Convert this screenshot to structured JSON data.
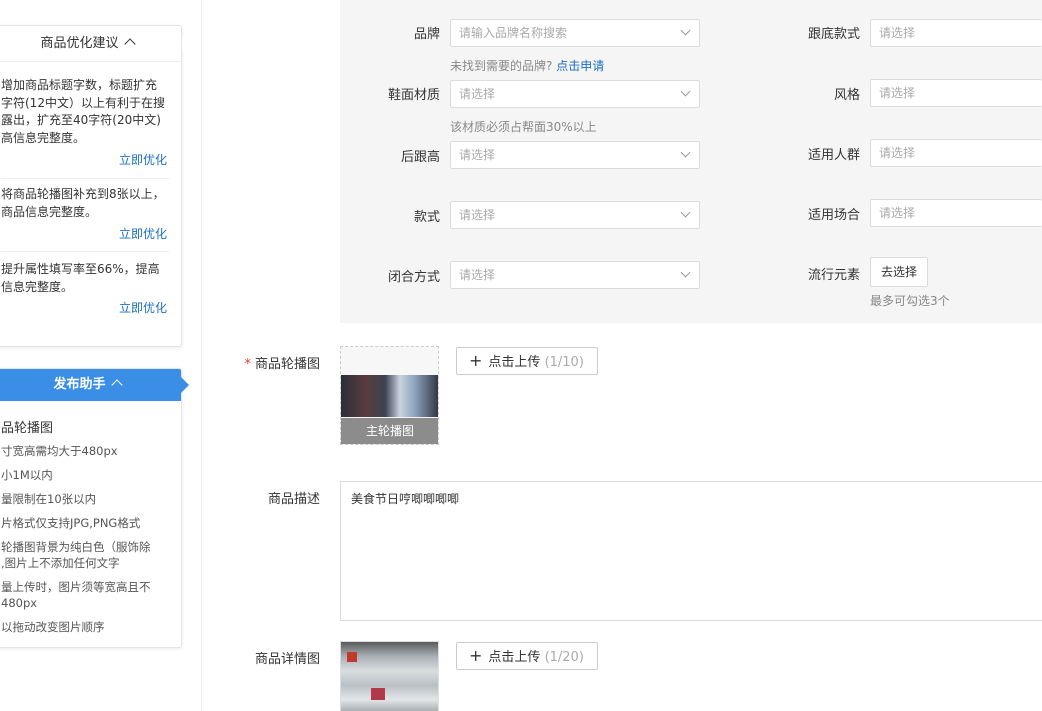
{
  "sidebar": {
    "optimize": {
      "title": "商品优化建议",
      "items": [
        {
          "lines": [
            "增加商品标题字数，标题扩充",
            "字符(12中文）以上有利于在搜",
            "露出，扩充至40字符(20中文)",
            "高信息完整度。"
          ],
          "link": "立即优化"
        },
        {
          "lines": [
            "将商品轮播图补充到8张以上，",
            "商品信息完整度。"
          ],
          "link": "立即优化"
        },
        {
          "lines": [
            "提升属性填写率至66%，提高",
            "信息完整度。"
          ],
          "link": "立即优化"
        }
      ]
    },
    "helper": {
      "title": "发布助手",
      "section_title": "品轮播图",
      "lines": [
        "寸宽高需均大于480px",
        "小1M以内",
        "量限制在10张以内",
        "片格式仅支持JPG,PNG格式",
        "轮播图背景为纯白色（服饰除",
        ",图片上不添加任何文字",
        "量上传时，图片须等宽高且不",
        "480px",
        "以拖动改变图片顺序"
      ]
    }
  },
  "attrs": {
    "brand": {
      "label": "品牌",
      "placeholder": "请输入品牌名称搜索"
    },
    "brand_hint": {
      "text": "未找到需要的品牌?",
      "link": "点击申请"
    },
    "upper_material": {
      "label": "鞋面材质",
      "placeholder": "请选择"
    },
    "material_hint": "该材质必须占帮面30%以上",
    "heel_height": {
      "label": "后跟高",
      "placeholder": "请选择"
    },
    "style": {
      "label": "款式",
      "placeholder": "请选择"
    },
    "closure": {
      "label": "闭合方式",
      "placeholder": "请选择"
    },
    "sole_style": {
      "label": "跟底款式",
      "placeholder": "请选择"
    },
    "fashion": {
      "label": "风格",
      "placeholder": "请选择"
    },
    "crowd": {
      "label": "适用人群",
      "placeholder": "请选择"
    },
    "occasion": {
      "label": "适用场合",
      "placeholder": "请选择"
    },
    "trend": {
      "label": "流行元素",
      "button": "去选择",
      "hint": "最多可勾选3个"
    }
  },
  "carousel": {
    "required_mark": "*",
    "label": "商品轮播图",
    "main_caption": "主轮播图",
    "upload_label": "点击上传",
    "upload_count": "(1/10)"
  },
  "description": {
    "label": "商品描述",
    "value": "美食节日哼唧唧唧唧"
  },
  "detail": {
    "label": "商品详情图",
    "upload_label": "点击上传",
    "upload_count": "(1/20)"
  }
}
